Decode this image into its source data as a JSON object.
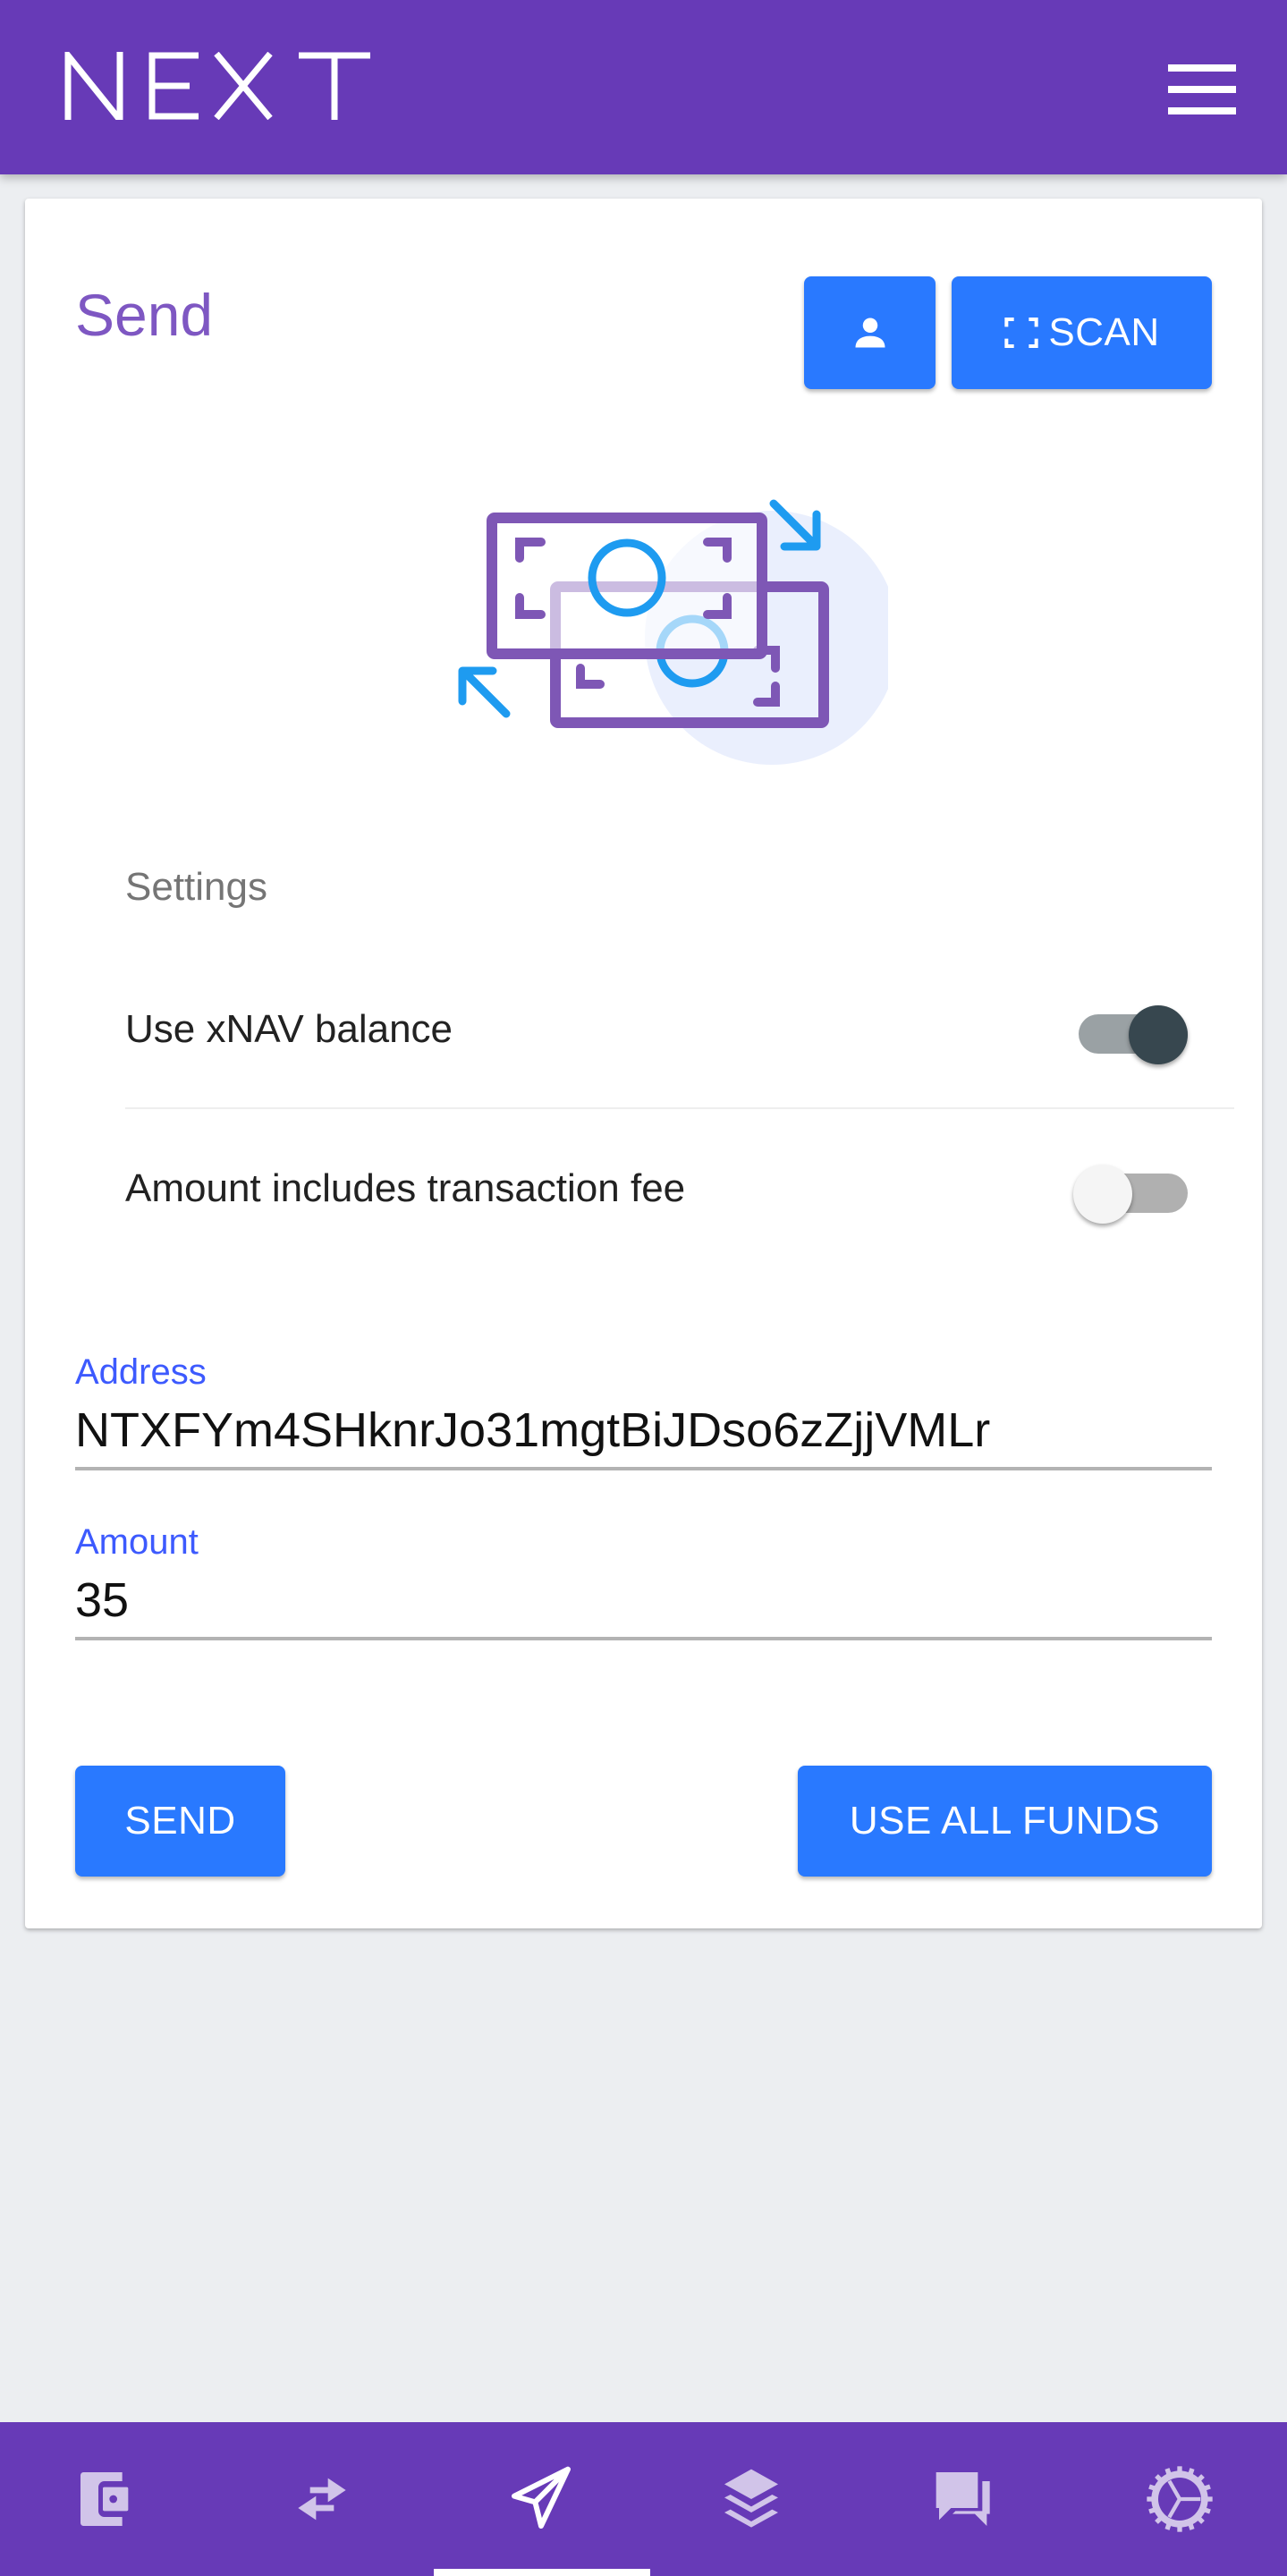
{
  "app": {
    "brand": "NEXT",
    "colors": {
      "primary": "#673ab7",
      "accent_button": "#2979ff",
      "title": "#7e57c2",
      "label": "#3d5afe"
    }
  },
  "header": {
    "logo_text": "NEXT",
    "menu_icon": "hamburger-menu-icon"
  },
  "send_card": {
    "title": "Send",
    "contact_button": {
      "icon": "person-icon"
    },
    "scan_button": {
      "label": "SCAN",
      "icon": "scan-frame-icon"
    },
    "illustration": "money-transfer-illustration"
  },
  "settings": {
    "heading": "Settings",
    "items": [
      {
        "label": "Use xNAV balance",
        "enabled": true
      },
      {
        "label": "Amount includes transaction fee",
        "enabled": false
      }
    ]
  },
  "form": {
    "address": {
      "label": "Address",
      "value": "NTXFYm4SHknrJo31mgtBiJDso6zZjjVMLr"
    },
    "amount": {
      "label": "Amount",
      "value": "35"
    }
  },
  "actions": {
    "send_label": "SEND",
    "use_all_funds_label": "USE ALL FUNDS"
  },
  "bottom_nav": {
    "active_index": 2,
    "items": [
      {
        "name": "wallet",
        "icon": "wallet-icon"
      },
      {
        "name": "swap",
        "icon": "swap-arrows-icon"
      },
      {
        "name": "send",
        "icon": "paper-plane-icon"
      },
      {
        "name": "staking",
        "icon": "layers-icon"
      },
      {
        "name": "community",
        "icon": "chat-bubbles-icon"
      },
      {
        "name": "settings",
        "icon": "gear-icon"
      }
    ]
  }
}
